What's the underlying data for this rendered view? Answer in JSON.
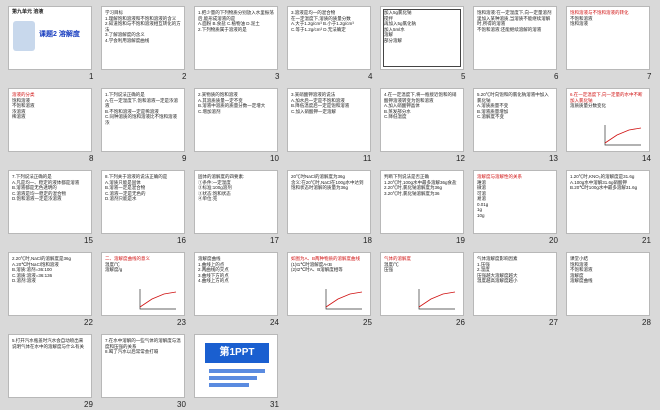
{
  "slides": [
    {
      "n": "1",
      "title": "第九单元 溶液",
      "sub": "课题2 溶解度",
      "kind": "cover"
    },
    {
      "n": "2",
      "lines": [
        "学习目标",
        "1.理解饱和溶液和不饱和溶液的含义",
        "2.知道饱和与不饱和溶液相互转化的方法",
        "3.了解溶解度的含义",
        "4.学会利用溶解度曲线"
      ],
      "kind": "text"
    },
    {
      "n": "3",
      "lines": [
        "1.把少量的下列物质分别放入水里振荡后,能形成溶液的是",
        "A.面粉 B.食盐 C.植物油 D.泥土",
        "2.下列物质属于溶液的是"
      ],
      "kind": "text"
    },
    {
      "n": "4",
      "lines": [
        "3.溶液是均一的混合物",
        "在一定温度下,溶质的质量分数",
        "A.大于1.2g/cm³ B.小于1.2g/cm³",
        "C.等于1.2g/cm³ D.无法确定"
      ],
      "kind": "text"
    },
    {
      "n": "5",
      "lines": [
        "加入5g氯化钠",
        "搅拌",
        "再加入5g氯化钠",
        "加入5ml水",
        "溶解",
        "部分溶解"
      ],
      "kind": "table"
    },
    {
      "n": "6",
      "lines": [
        "饱和溶液:在一定温度下,向一定量溶剂里加入某种溶质,当溶质不能继续溶解时,所得的溶液",
        "不饱和溶液:还能继续溶解的溶液"
      ],
      "kind": "text"
    },
    {
      "n": "7",
      "lines": [
        "饱和溶液与不饱和溶液的转化",
        "不饱和溶液",
        "饱和溶液"
      ],
      "kind": "diagram"
    },
    {
      "n": "8",
      "lines": [
        "溶液的分类",
        "饱和溶液",
        "不饱和溶液",
        "浓溶液",
        "稀溶液"
      ],
      "kind": "diagram"
    },
    {
      "n": "9",
      "lines": [
        "1.下列说法正确的是",
        "A.在一定温度下,饱和溶液一定是浓溶液",
        "B.不饱和溶液一定是稀溶液",
        "C.同种溶质的饱和溶液比不饱和溶液浓"
      ],
      "kind": "text"
    },
    {
      "n": "10",
      "lines": [
        "2.某物质的饱和溶液",
        "A.其溶质质量一定不变",
        "B.溶液中溶质的质量分数一定增大",
        "C.增加溶剂"
      ],
      "kind": "text"
    },
    {
      "n": "11",
      "lines": [
        "3.某硝酸钾溶液的说法",
        "A.加水后一定是不饱和溶液",
        "B.降低温度后一定是饱和溶液",
        "C.加入硝酸钾一定溶解"
      ],
      "kind": "text"
    },
    {
      "n": "12",
      "lines": [
        "4.在一定温度下,将一瓶接近饱和的硝酸钾溶液转变为饱和溶液",
        "A.加入硝酸钾晶体",
        "B.蒸发部分水",
        "C.降低温度"
      ],
      "kind": "text"
    },
    {
      "n": "13",
      "lines": [
        "5.20℃时向饱和的氯化钠溶液中加入氯化钠",
        "A.溶质质量不变",
        "B.溶液质量增加",
        "C.溶解度不变"
      ],
      "kind": "text"
    },
    {
      "n": "14",
      "lines": [
        "6.在一定温度下,向一定量的水中不断加入氯化钠",
        "溶质质量分数变化"
      ],
      "kind": "chart"
    },
    {
      "n": "15",
      "lines": [
        "7.下列说法正确的是",
        "A.凡是均一、稳定的液体都是溶液",
        "B.溶液都是无色透明的",
        "C.溶液是均一稳定的混合物",
        "D.饱和溶液一定是浓溶液"
      ],
      "kind": "text"
    },
    {
      "n": "16",
      "lines": [
        "8.下列关于溶液的说法正确的是",
        "A.溶质只能是固体",
        "B.溶液一定是混合物",
        "C.溶液一定是无色的",
        "D.溶剂只能是水"
      ],
      "kind": "text"
    },
    {
      "n": "17",
      "lines": [
        "固体的溶解度的四要素:",
        "①条件:一定温度",
        "②标准:100g溶剂",
        "③状态:饱和状态",
        "④单位:克"
      ],
      "kind": "text"
    },
    {
      "n": "18",
      "lines": [
        "20℃时NaCl的溶解度为36g",
        "含义:在20℃时,NaCl在100g水中达到饱和状态时溶解的质量为36g"
      ],
      "kind": "text"
    },
    {
      "n": "19",
      "lines": [
        "判断下列说法是否正确",
        "1.20℃时,100g水中最多溶解36g食盐",
        "2.20℃时,氯化钠溶解度为36g",
        "3.20℃时,氯化钠溶解度为36"
      ],
      "kind": "text"
    },
    {
      "n": "20",
      "lines": [
        "溶解度与溶解性的关系",
        "难溶",
        "微溶",
        "可溶",
        "易溶",
        "0.01g",
        "1g",
        "10g"
      ],
      "kind": "diagram"
    },
    {
      "n": "21",
      "lines": [
        "1.20℃时,KNO₃的溶解度是31.6g",
        "A.100g水中溶解31.6g硝酸钾",
        "B.20℃时100g水中最多溶解31.6g"
      ],
      "kind": "text"
    },
    {
      "n": "22",
      "lines": [
        "2.20℃时,NaCl的溶解度是36g",
        "",
        "A.20℃时NaCl饱和溶液",
        "B.溶质:溶剂=36:100",
        "C.溶质:溶液=36:136",
        "D.溶剂:溶液"
      ],
      "kind": "text"
    },
    {
      "n": "23",
      "lines": [
        "二、溶解度曲线的意义",
        "温度/℃",
        "溶解度/g"
      ],
      "kind": "chart"
    },
    {
      "n": "24",
      "lines": [
        "溶解度曲线",
        "1.曲线上的点",
        "2.两曲线的交点",
        "3.曲线下方的点",
        "4.曲线上方的点"
      ],
      "kind": "text"
    },
    {
      "n": "25",
      "lines": [
        "如图为A、B两种物质的溶解度曲线",
        "(1)t1℃时溶解度A<B",
        "(2)t2℃时A、B溶解度相等"
      ],
      "kind": "chart"
    },
    {
      "n": "26",
      "lines": [
        "气体的溶解度",
        "温度/℃",
        "压强"
      ],
      "kind": "chart"
    },
    {
      "n": "27",
      "lines": [
        "气体溶解度影响因素",
        "1.压强",
        "2.温度",
        "压强越大溶解度越大",
        "温度越高溶解度越小"
      ],
      "kind": "text"
    },
    {
      "n": "28",
      "lines": [
        "课堂小结",
        "饱和溶液",
        "不饱和溶液",
        "溶解度",
        "溶解度曲线"
      ],
      "kind": "text"
    },
    {
      "n": "29",
      "lines": [
        "5.打开汽水瓶盖时汽水会自动喷出来",
        "说明气体在水中的溶解度与什么有关"
      ],
      "kind": "text"
    },
    {
      "n": "30",
      "lines": [
        "7.在水中溶解的一些气体的溶解度与温度和压强的关系",
        "8.喝了汽水以后常常会打嗝"
      ],
      "kind": "text"
    },
    {
      "n": "31",
      "lines": [
        "第1PPT"
      ],
      "kind": "ppt"
    }
  ],
  "colors": {
    "accent": "#d01010",
    "blue": "#1a3fc0",
    "select": "#3a6fd8"
  }
}
